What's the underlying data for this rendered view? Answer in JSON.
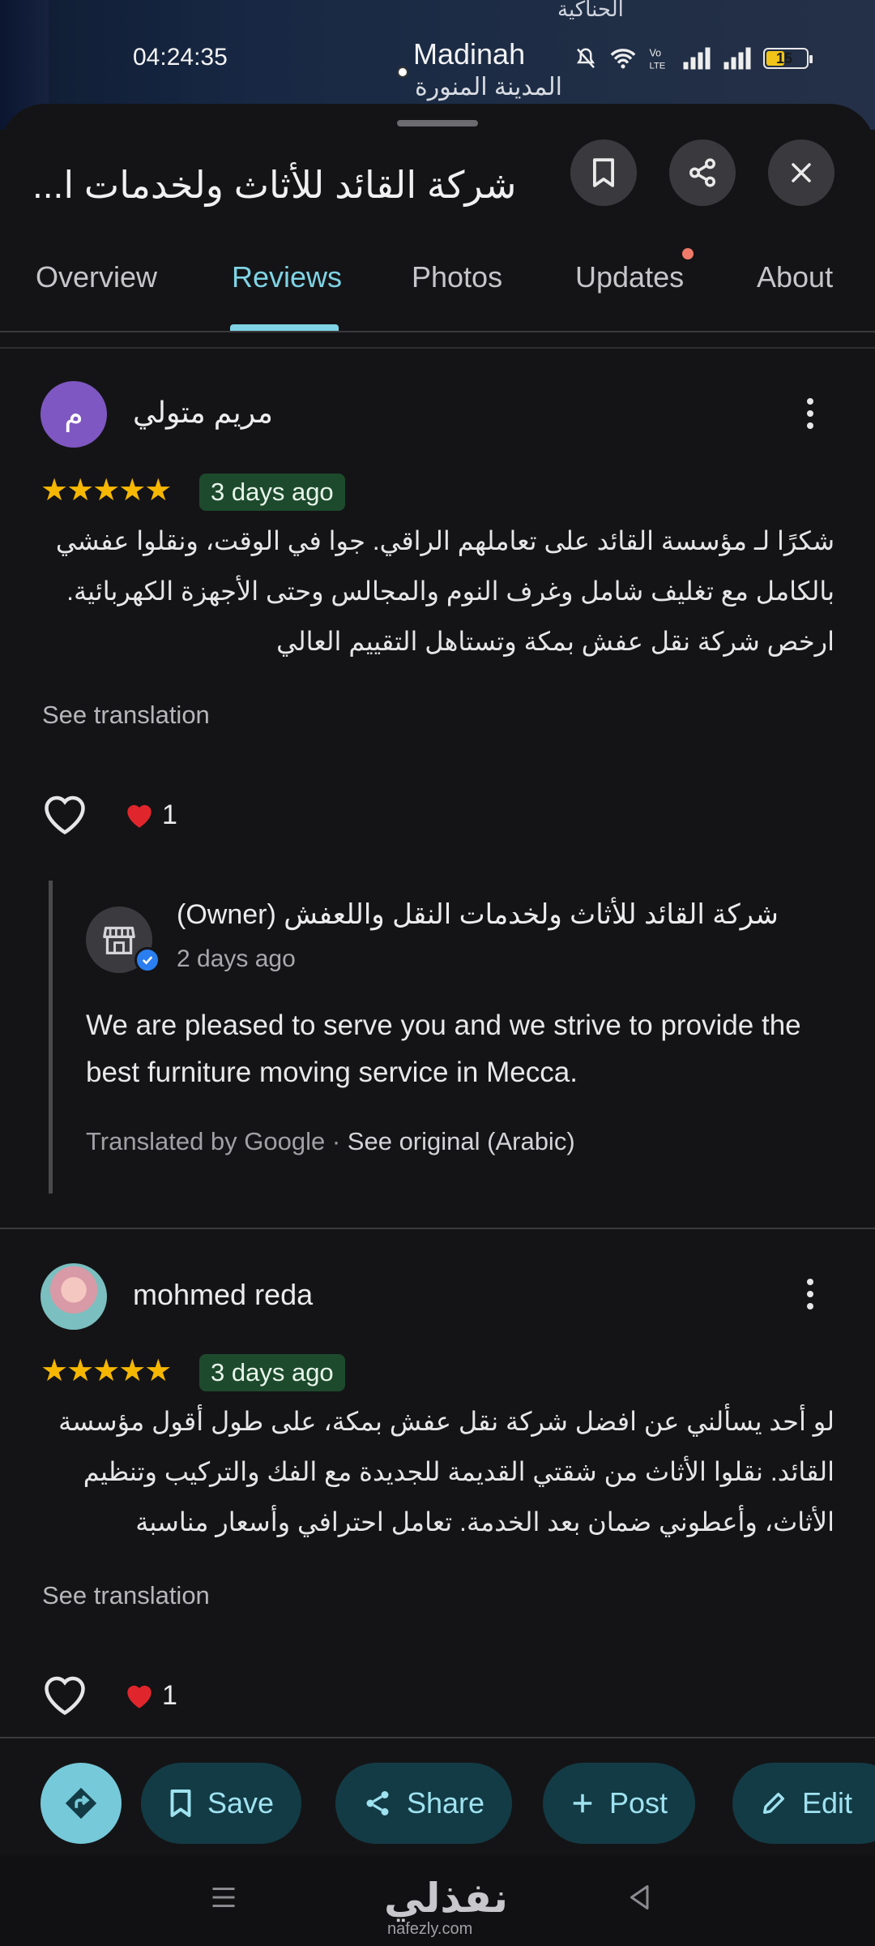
{
  "status_bar": {
    "time": "04:24:35",
    "battery": "15"
  },
  "map": {
    "top_label": "الحناكية",
    "city_en": "Madinah",
    "city_ar": "المدينة المنورة"
  },
  "place": {
    "title": "شركة القائد للأثاث ولخدمات ا..."
  },
  "header_icons": [
    "bookmark-icon",
    "share-icon",
    "close-icon"
  ],
  "tabs": [
    {
      "label": "Overview"
    },
    {
      "label": "Reviews"
    },
    {
      "label": "Photos"
    },
    {
      "label": "Updates"
    },
    {
      "label": "About"
    }
  ],
  "active_tab": "Reviews",
  "reviews": [
    {
      "avatar_letter": "م",
      "author": "مريم متولي",
      "rating": 5,
      "date": "3 days ago",
      "text": "شكرًا لـ مؤسسة القائد على تعاملهم الراقي. جوا في الوقت، ونقلوا عفشي بالكامل مع تغليف شامل وغرف النوم والمجالس وحتى الأجهزة الكهربائية. ارخص شركة نقل عفش بمكة وتستاهل التقييم العالي",
      "see_translation": "See translation",
      "likes": "1",
      "owner_response": {
        "name": "شركة القائد للأثاث ولخدمات النقل واللعفش",
        "owner_tag": "(Owner)",
        "date": "2 days ago",
        "text": "We are pleased to serve you and we strive to provide the best furniture moving service in Mecca.",
        "translated_by": "Translated by Google · ",
        "see_original": "See original (Arabic)"
      }
    },
    {
      "author": "mohmed reda",
      "rating": 5,
      "date": "3 days ago",
      "text": "لو أحد يسألني عن افضل شركة نقل عفش بمكة، على طول أقول مؤسسة القائد. نقلوا الأثاث من شقتي القديمة للجديدة مع الفك والتركيب وتنظيم الأثاث، وأعطوني ضمان بعد الخدمة. تعامل احترافي وأسعار مناسبة",
      "see_translation": "See translation",
      "likes": "1"
    }
  ],
  "stars_text": "★★★★★",
  "actions": {
    "save": "Save",
    "share": "Share",
    "post": "Post",
    "edit": "Edit"
  },
  "watermark": {
    "text": "نفذلي",
    "sub": "nafezly.com"
  },
  "colors": {
    "accent": "#7fd3e4",
    "star": "#f6b700",
    "badge_bg": "#1d4a2d",
    "pill_bg": "#133b45",
    "heart": "#e0262c"
  }
}
